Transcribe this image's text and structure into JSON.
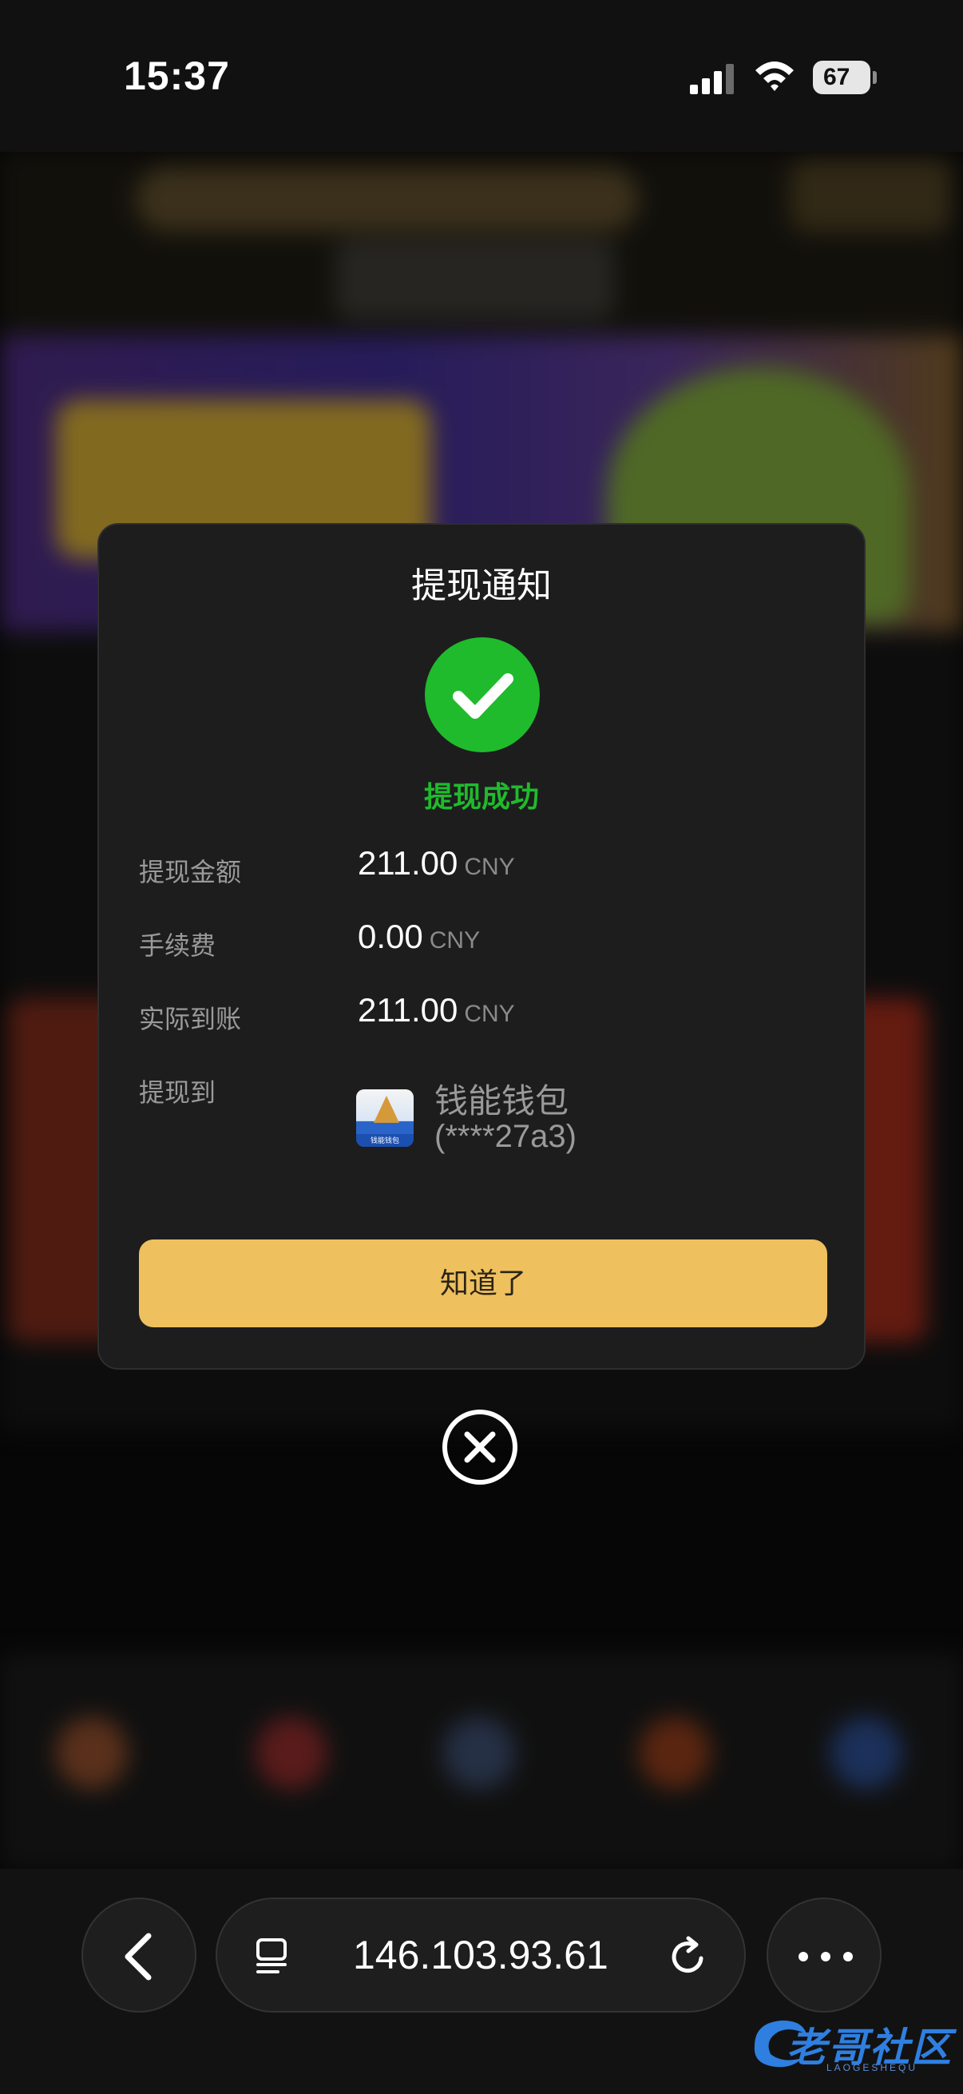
{
  "status_bar": {
    "time": "15:37",
    "battery": "67"
  },
  "modal": {
    "title": "提现通知",
    "status": "提现成功",
    "rows": [
      {
        "label": "提现金额",
        "value": "211.00",
        "unit": "CNY"
      },
      {
        "label": "手续费",
        "value": "0.00",
        "unit": "CNY"
      },
      {
        "label": "实际到账",
        "value": "211.00",
        "unit": "CNY"
      }
    ],
    "destination": {
      "label": "提现到",
      "wallet_name": "钱能钱包",
      "account": "(****27a3)",
      "icon_caption": "钱能钱包"
    },
    "confirm_label": "知道了"
  },
  "browser": {
    "url": "146.103.93.61"
  },
  "watermark": {
    "text": "老哥社区",
    "sub": "LAOGESHEQU"
  },
  "colors": {
    "success": "#1fbb2c",
    "button": "#eec05e",
    "modal_bg": "#1d1d1e"
  }
}
